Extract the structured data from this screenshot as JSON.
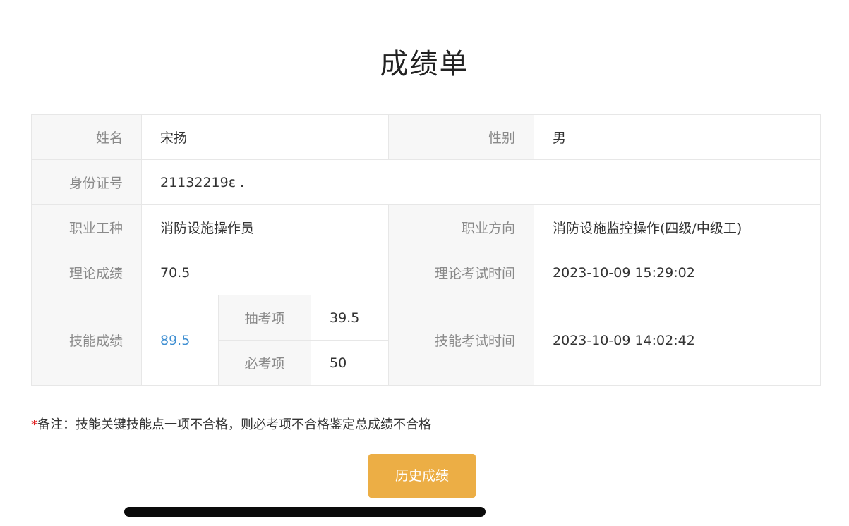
{
  "title": "成绩单",
  "table": {
    "name_label": "姓名",
    "name_value": "宋扬",
    "gender_label": "性别",
    "gender_value": "男",
    "id_label": "身份证号",
    "id_value": "21132219ɛ .",
    "occupation_label": "职业工种",
    "occupation_value": "消防设施操作员",
    "direction_label": "职业方向",
    "direction_value": "消防设施监控操作(四级/中级工)",
    "theory_label": "理论成绩",
    "theory_value": "70.5",
    "theory_time_label": "理论考试时间",
    "theory_time_value": "2023-10-09 15:29:02",
    "skill_label": "技能成绩",
    "skill_value": "89.5",
    "random_item_label": "抽考项",
    "random_item_value": "39.5",
    "required_item_label": "必考项",
    "required_item_value": "50",
    "skill_time_label": "技能考试时间",
    "skill_time_value": "2023-10-09 14:02:42"
  },
  "note": {
    "star": "*",
    "text": "备注：技能关键技能点一项不合格，则必考项不合格鉴定总成绩不合格"
  },
  "history_button": "历史成绩",
  "colors": {
    "button": "#ecae45",
    "link": "#3f8fd2",
    "required_star": "#e02020"
  }
}
